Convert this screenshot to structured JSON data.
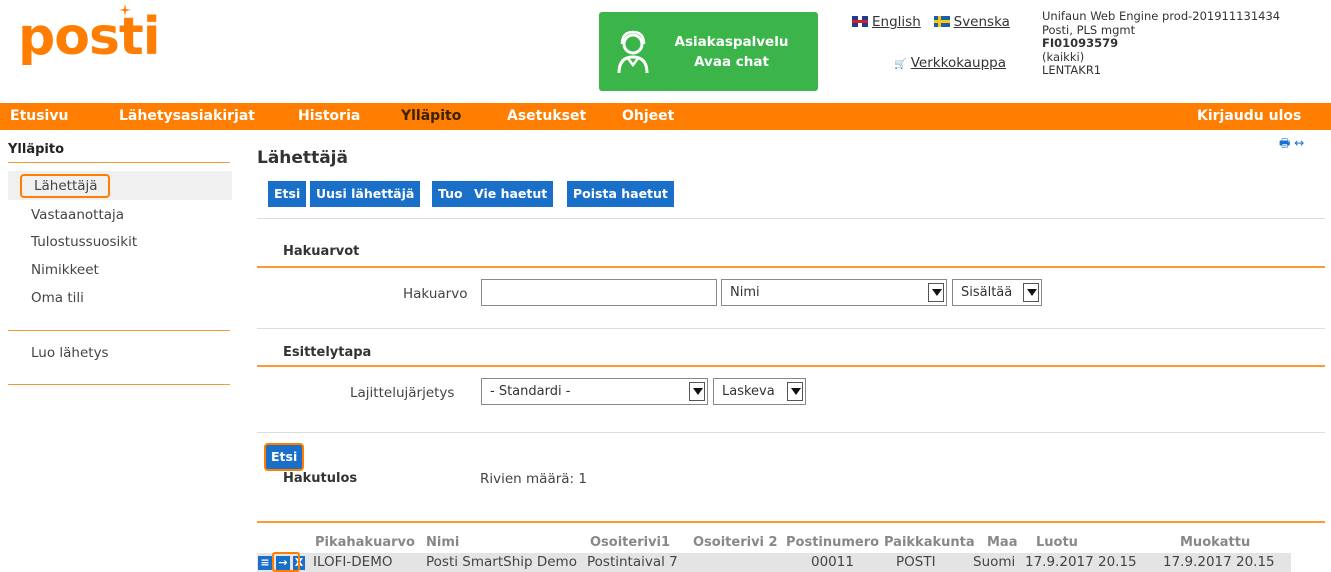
{
  "header": {
    "logo_text": "posti",
    "chat": {
      "line1": "Asiakaspalvelu",
      "line2": "Avaa chat"
    },
    "lang_english": "English",
    "lang_swedish": "Svenska",
    "shop_link": "Verkkokauppa",
    "shop_icon": "🛒",
    "env": {
      "line1": "Unifaun Web Engine prod-201911131434",
      "line2": "Posti, PLS mgmt",
      "line3": "FI01093579",
      "line4": "(kaikki)",
      "line5": "LENTAKR1"
    }
  },
  "nav": {
    "items": [
      "Etusivu",
      "Lähetysasiakirjat",
      "Historia",
      "Ylläpito",
      "Asetukset",
      "Ohjeet"
    ],
    "logout": "Kirjaudu ulos"
  },
  "sidebar": {
    "title": "Ylläpito",
    "items": [
      "Lähettäjä",
      "Vastaanottaja",
      "Tulostussuosikit",
      "Nimikkeet",
      "Oma tili"
    ],
    "create": "Luo lähetys"
  },
  "main": {
    "title": "Lähettäjä",
    "top_icons": "🖶 ↔",
    "buttons": [
      "Etsi",
      "Uusi lähettäjä",
      "Tuo",
      "Vie haetut",
      "Poista haetut"
    ],
    "search_section": {
      "heading": "Hakuarvot",
      "label": "Hakuarvo",
      "input_value": "",
      "field_select": "Nimi",
      "match_select": "Sisältää"
    },
    "display_section": {
      "heading": "Esittelytapa",
      "label": "Lajittelujärjetys",
      "sort_select": "- Standardi -",
      "order_select": "Laskeva"
    },
    "search_button": "Etsi",
    "results": {
      "heading": "Hakutulos",
      "row_count": "Rivien määrä: 1",
      "columns": [
        "Pikahakuarvo",
        "Nimi",
        "Osoiterivi1",
        "Osoiterivi 2",
        "Postinumero",
        "Paikkakunta",
        "Maa",
        "Luotu",
        "Muokattu"
      ],
      "rows": [
        [
          "ILOFI-DEMO",
          "Posti SmartShip Demo",
          "Postintaival 7",
          "",
          "00011",
          "POSTI",
          "Suomi",
          "17.9.2017 20.15",
          "17.9.2017 20.15"
        ]
      ],
      "row_icons": [
        "≡",
        "→",
        "X"
      ]
    }
  }
}
